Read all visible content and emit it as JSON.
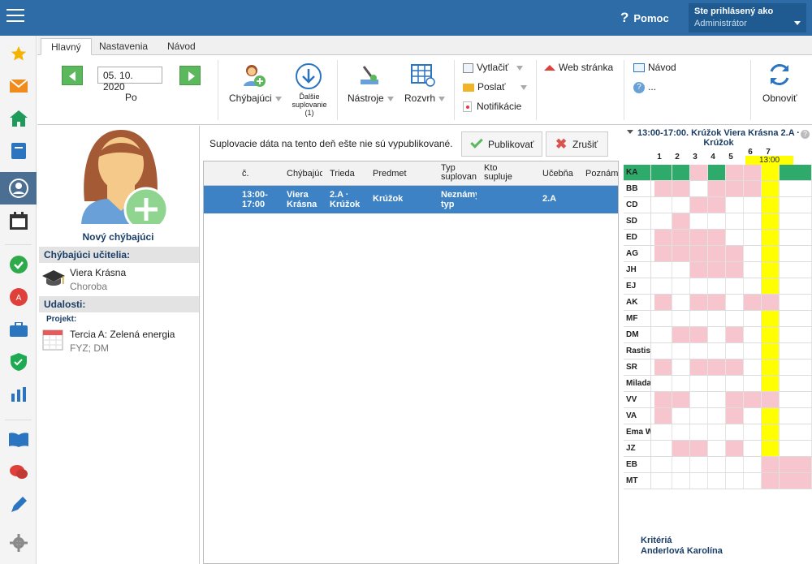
{
  "topbar": {
    "help_label": "Pomoc",
    "user_line1": "Ste prihlásený ako",
    "user_line2": "Administrátor"
  },
  "tabs": [
    {
      "label": "Hlavný",
      "active": true
    },
    {
      "label": "Nastavenia",
      "active": false
    },
    {
      "label": "Návod",
      "active": false
    }
  ],
  "ribbon": {
    "date": "05. 10. 2020",
    "day": "Po",
    "absent_label": "Chýbajúci",
    "more_subs_l1": "Ďalšie",
    "more_subs_l2": "suplovanie",
    "more_subs_l3": "(1)",
    "tools_label": "Nástroje",
    "schedule_label": "Rozvrh",
    "print_label": "Vytlačiť",
    "send_label": "Poslať",
    "notif_label": "Notifikácie",
    "web_label": "Web stránka",
    "guide_label": "Návod",
    "dots_label": "...",
    "refresh_label": "Obnoviť"
  },
  "left": {
    "new_absent": "Nový chýbajúci",
    "absent_teachers_hdr": "Chýbajúci učitelia:",
    "teacher_name": "Viera Krásna",
    "teacher_reason": "Choroba",
    "events_hdr": "Udalosti:",
    "project_label": "Projekt:",
    "event_name": "Tercia A: Zelená energia",
    "event_subjects": "FYZ; DM"
  },
  "center": {
    "notice": "Suplovacie dáta na tento deň ešte nie sú vypublikované.",
    "publish_label": "Publikovať",
    "cancel_label": "Zrušiť",
    "columns": [
      "č.",
      "Chýbajúci",
      "Trieda",
      "Predmet",
      "Typ suplovania",
      "Kto supluje",
      "Učebňa",
      "Poznámka"
    ],
    "row": {
      "time": "13:00-17:00",
      "absent": "Viera Krásna",
      "class": "2.A · Krúžok",
      "subject": "Krúžok",
      "type": "Neznámy typ",
      "room": "2.A"
    }
  },
  "schedule": {
    "title": "13:00-17:00. Krúžok Viera Krásna 2.A · Krúžok",
    "periods": [
      "1",
      "2",
      "3",
      "4",
      "5",
      "6",
      "7"
    ],
    "highlight_time": "13:00",
    "rows": [
      {
        "name": "KA",
        "cells": [
          "g",
          "g",
          "p",
          "g",
          "p",
          "p",
          "y",
          "g"
        ]
      },
      {
        "name": "BB",
        "cells": [
          "p",
          "p",
          "w",
          "p",
          "p",
          "p",
          "y",
          "w"
        ]
      },
      {
        "name": "CD",
        "cells": [
          "w",
          "w",
          "p",
          "p",
          "w",
          "w",
          "y",
          "w"
        ]
      },
      {
        "name": "SD",
        "cells": [
          "w",
          "p",
          "w",
          "w",
          "w",
          "w",
          "y",
          "w"
        ]
      },
      {
        "name": "ED",
        "cells": [
          "p",
          "p",
          "p",
          "p",
          "w",
          "w",
          "y",
          "w"
        ]
      },
      {
        "name": "AG",
        "cells": [
          "p",
          "p",
          "p",
          "p",
          "p",
          "w",
          "y",
          "w"
        ]
      },
      {
        "name": "JH",
        "cells": [
          "w",
          "w",
          "p",
          "p",
          "p",
          "w",
          "y",
          "w"
        ]
      },
      {
        "name": "EJ",
        "cells": [
          "w",
          "w",
          "w",
          "w",
          "w",
          "w",
          "y",
          "w"
        ]
      },
      {
        "name": "AK",
        "cells": [
          "p",
          "w",
          "p",
          "p",
          "w",
          "p",
          "p",
          "w"
        ]
      },
      {
        "name": "MF",
        "cells": [
          "w",
          "w",
          "w",
          "w",
          "w",
          "w",
          "y",
          "w"
        ]
      },
      {
        "name": "DM",
        "cells": [
          "w",
          "p",
          "p",
          "w",
          "p",
          "w",
          "y",
          "w"
        ]
      },
      {
        "name": "Rastislav",
        "cells": [
          "w",
          "w",
          "w",
          "w",
          "w",
          "w",
          "y",
          "w"
        ]
      },
      {
        "name": "SR",
        "cells": [
          "p",
          "w",
          "p",
          "p",
          "p",
          "w",
          "y",
          "w"
        ]
      },
      {
        "name": "Milada",
        "cells": [
          "w",
          "w",
          "w",
          "w",
          "w",
          "w",
          "y",
          "w"
        ]
      },
      {
        "name": "VV",
        "cells": [
          "p",
          "p",
          "w",
          "w",
          "p",
          "p",
          "p",
          "w"
        ]
      },
      {
        "name": "VA",
        "cells": [
          "p",
          "w",
          "w",
          "w",
          "p",
          "w",
          "y",
          "w"
        ]
      },
      {
        "name": "Ema W",
        "cells": [
          "w",
          "w",
          "w",
          "w",
          "w",
          "w",
          "y",
          "w"
        ]
      },
      {
        "name": "JZ",
        "cells": [
          "w",
          "p",
          "p",
          "w",
          "p",
          "w",
          "y",
          "w"
        ]
      },
      {
        "name": "EB",
        "cells": [
          "w",
          "w",
          "w",
          "w",
          "w",
          "w",
          "p",
          "p"
        ]
      },
      {
        "name": "MT",
        "cells": [
          "w",
          "w",
          "w",
          "w",
          "w",
          "w",
          "p",
          "p"
        ]
      }
    ],
    "footer1": "Kritériá",
    "footer2": "Anderlová Karolína"
  },
  "colors": {
    "topbar": "#2d6ca6",
    "selected_row": "#3d82c4",
    "busy": "#f7c5cd",
    "free_highlight": "#ffff00",
    "own": "#2eaa6a"
  }
}
